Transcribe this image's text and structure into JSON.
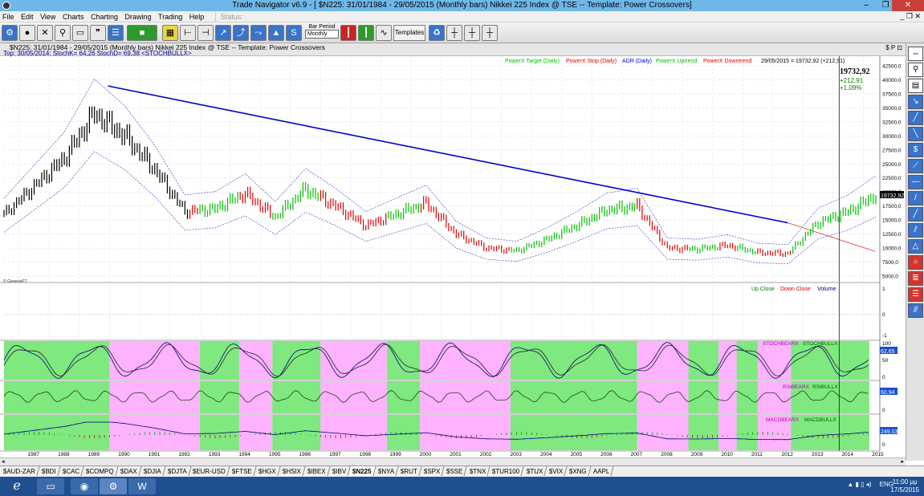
{
  "window": {
    "title": "Trade Navigator v6.9 - [ $N225: 31/01/1984 - 29/05/2015  (Monthly bars)  Nikkei 225 Index @ TSE  --  Template: Power Crossovers]",
    "min": "–",
    "max": "❐",
    "close": "✕"
  },
  "menu": {
    "items": [
      "File",
      "Edit",
      "View",
      "Charts",
      "Charting",
      "Drawing",
      "Trading",
      "Help"
    ],
    "status_label": "Status:",
    "right_controls": "_ ❐ ✕"
  },
  "toolbar": {
    "bar_period_label": "Bar Period",
    "bar_period_value": "Monthly",
    "templates_label": "Templates"
  },
  "chart_header": {
    "line1": "$N225:  31/01/1984 - 29/05/2015  (Monthly bars)   Nikkei 225 Index @ TSE  --  Template: Power Crossovers",
    "line2": "Top:  30/05/2014:  StochK= 64,26  StochD= 69,38  <STOCHBULLX>",
    "icons": "$ P ⊡"
  },
  "chart_data": {
    "type": "line",
    "x": [
      "1987",
      "1988",
      "1989",
      "1990",
      "1991",
      "1992",
      "1993",
      "1994",
      "1995",
      "1996",
      "1997",
      "1998",
      "1999",
      "2000",
      "2001",
      "2002",
      "2003",
      "2004",
      "2005",
      "2006",
      "2007",
      "2008",
      "2009",
      "2010",
      "2011",
      "2012",
      "2013",
      "2014",
      "2015"
    ],
    "series": [
      {
        "name": "",
        "values": [
          21000,
          26000,
          34000,
          30000,
          24000,
          16500,
          17000,
          19700,
          15500,
          20500,
          17500,
          14000,
          16000,
          18000,
          12500,
          10000,
          9500,
          11500,
          14000,
          16800,
          17500,
          10000,
          9800,
          10500,
          9200,
          9000,
          14500,
          16500,
          19700
        ]
      }
    ],
    "ylim": [
      5000,
      42500
    ],
    "y_ticks": [
      "42500,0",
      "40000,0",
      "37500,0",
      "35000,0",
      "32500,0",
      "30000,0",
      "27500,0",
      "25000,0",
      "22500,0",
      "20000,0",
      "17500,0",
      "15000,0",
      "12500,0",
      "10000,0",
      "7500,0",
      "5000,0"
    ],
    "legend": [
      {
        "label": "PowerX Target (Daily)",
        "color": "#00c000"
      },
      {
        "label": "PowerX Stop (Daily)",
        "color": "#e00000"
      },
      {
        "label": "ADR (Daily)",
        "color": "#0000e0"
      },
      {
        "label": "PowerX Uptrend",
        "color": "#00c000"
      },
      {
        "label": "PowerX Downtrend",
        "color": "#e00000"
      }
    ],
    "legend_info": "29/05/2015 = 19732,92 (+212,91)",
    "last_price": "19732,92",
    "change_abs": "+212,91",
    "change_pct": "+1,09%",
    "price_tag": "19732,92",
    "source": "© GenesisFT",
    "volume_legend": [
      {
        "label": "Up Close",
        "color": "#008000"
      },
      {
        "label": "Down Close",
        "color": "#e00000"
      },
      {
        "label": "Volume",
        "color": "#000080"
      }
    ],
    "volume_ticks": [
      "1",
      "0",
      "-1"
    ],
    "stoch_label_bear": "STOCHBEARX",
    "stoch_label_bull": "STOCHBULLX",
    "stoch_tag": "62,65",
    "stoch_ticks": [
      "100",
      "50",
      "0"
    ],
    "rsi_label_bear": "RSIBEARX",
    "rsi_label_bull": "RSIBULLX",
    "rsi_tag": "60,94",
    "rsi_ticks": [
      "50",
      "0"
    ],
    "macd_label_bear": "MACDBEARX",
    "macd_label_bull": "MACDBULLX",
    "macd_tag": "249,03",
    "macd_ticks": [
      "0"
    ],
    "indicator_zones": [
      {
        "from": 1986.5,
        "to": 1990.0,
        "color": "green"
      },
      {
        "from": 1990.0,
        "to": 1993.0,
        "color": "pink"
      },
      {
        "from": 1993.0,
        "to": 1994.3,
        "color": "green"
      },
      {
        "from": 1994.3,
        "to": 1995.4,
        "color": "pink"
      },
      {
        "from": 1995.4,
        "to": 1997.0,
        "color": "green"
      },
      {
        "from": 1997.0,
        "to": 1999.2,
        "color": "pink"
      },
      {
        "from": 1999.2,
        "to": 2000.3,
        "color": "green"
      },
      {
        "from": 2000.3,
        "to": 2003.3,
        "color": "pink"
      },
      {
        "from": 2003.3,
        "to": 2007.5,
        "color": "green"
      },
      {
        "from": 2007.5,
        "to": 2009.2,
        "color": "pink"
      },
      {
        "from": 2009.2,
        "to": 2010.2,
        "color": "green"
      },
      {
        "from": 2010.2,
        "to": 2010.8,
        "color": "pink"
      },
      {
        "from": 2010.8,
        "to": 2011.5,
        "color": "green"
      },
      {
        "from": 2011.5,
        "to": 2012.6,
        "color": "pink"
      },
      {
        "from": 2012.6,
        "to": 2015.2,
        "color": "green"
      }
    ]
  },
  "symbol_tabs": [
    "$AUD-ZAR",
    "$BDI",
    "$CAC",
    "$COMPQ",
    "$DAX",
    "$DJIA",
    "$DJTA",
    "$EUR-USD",
    "$FTSE",
    "$HGX",
    "$HSIX",
    "$IBEX",
    "$IBV",
    "$N225",
    "$NYA",
    "$RUT",
    "$SPX",
    "$SSE",
    "$TNX",
    "$TUR100",
    "$TUX",
    "$VIX",
    "$XNG",
    "AAPL"
  ],
  "active_tab": "$N225",
  "taskbar": {
    "lang": "ENG",
    "time": "11:00 μμ",
    "date": "17/5/2015",
    "tray": "▲ ▮ ▯ ◂)"
  },
  "colors": {
    "up": "#00c000",
    "down": "#e00000",
    "trendline": "#0000cc",
    "indicator_pink": "#ffb3ff",
    "indicator_green": "#7fe87f"
  }
}
